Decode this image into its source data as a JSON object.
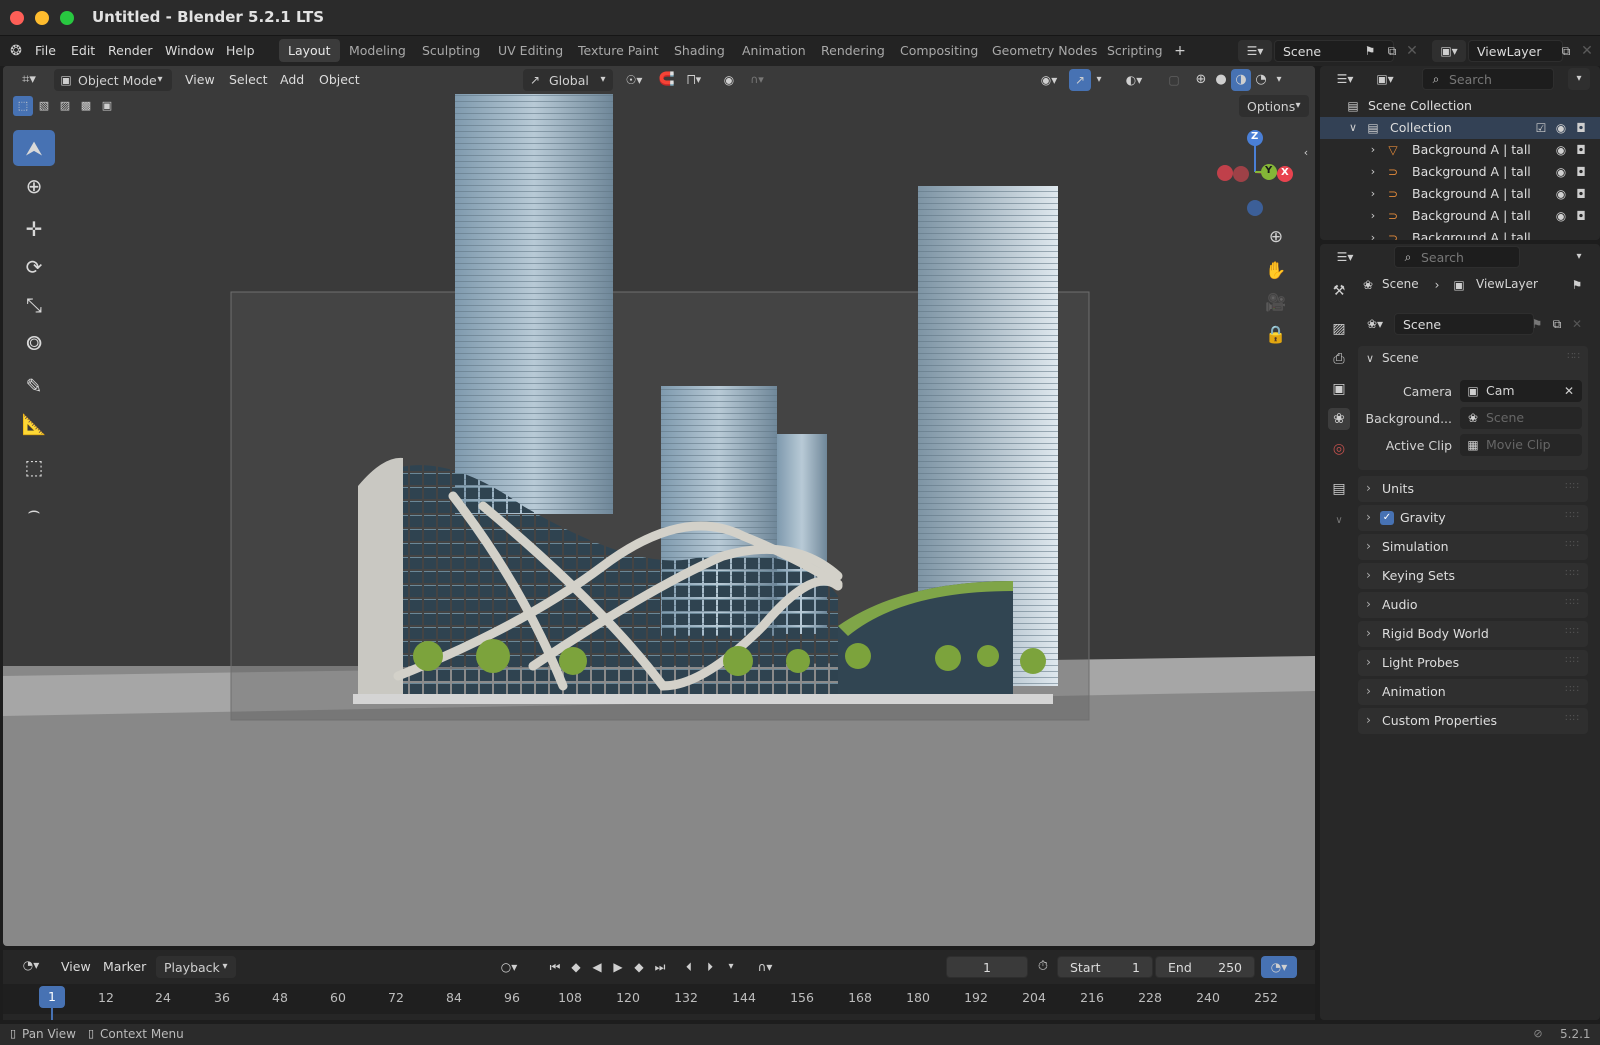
{
  "window": {
    "title": "Untitled - Blender 5.2.1 LTS"
  },
  "menu": {
    "items": [
      "File",
      "Edit",
      "Render",
      "Window",
      "Help"
    ]
  },
  "workspaces": [
    "Layout",
    "Modeling",
    "Sculpting",
    "UV Editing",
    "Texture Paint",
    "Shading",
    "Animation",
    "Rendering",
    "Compositing",
    "Geometry Nodes",
    "Scripting"
  ],
  "active_workspace": "Layout",
  "scene_field": "Scene",
  "viewlayer_field": "ViewLayer",
  "viewport": {
    "mode": "Object Mode",
    "menus": [
      "View",
      "Select",
      "Add",
      "Object"
    ],
    "transform_orientation": "Global",
    "options_label": "Options",
    "gizmo_axes": {
      "x": "X",
      "y": "Y",
      "z": "Z"
    }
  },
  "timeline": {
    "menus": [
      "View",
      "Marker",
      "Playback"
    ],
    "current_frame": "1",
    "start_label": "Start",
    "start_value": "1",
    "end_label": "End",
    "end_value": "250",
    "ruler": [
      "1",
      "12",
      "24",
      "36",
      "48",
      "60",
      "72",
      "84",
      "96",
      "108",
      "120",
      "132",
      "144",
      "156",
      "168",
      "180",
      "192",
      "204",
      "216",
      "228",
      "240",
      "252"
    ]
  },
  "status": {
    "left1": "Pan View",
    "left2": "Context Menu",
    "version": "5.2.1"
  },
  "outliner": {
    "search_placeholder": "Search",
    "scene_collection": "Scene Collection",
    "collection": "Collection",
    "objects": [
      "Background A | tall",
      "Background A | tall",
      "Background A | tall",
      "Background A | tall",
      "Background A | tall"
    ]
  },
  "properties": {
    "search_placeholder": "Search",
    "breadcrumb": [
      "Scene",
      "ViewLayer"
    ],
    "datablock": "Scene",
    "scene_panel": "Scene",
    "camera_label": "Camera",
    "camera_value": "Cam",
    "background_label": "Background...",
    "background_placeholder": "Scene",
    "active_clip_label": "Active Clip",
    "active_clip_placeholder": "Movie Clip",
    "panels": [
      "Units",
      "Gravity",
      "Simulation",
      "Keying Sets",
      "Audio",
      "Rigid Body World",
      "Light Probes",
      "Animation",
      "Custom Properties"
    ],
    "gravity_checked": true
  },
  "colors": {
    "accent": "#4772b3",
    "x_axis": "#e8434f",
    "y_axis": "#84b637",
    "z_axis": "#4a7fd6"
  }
}
